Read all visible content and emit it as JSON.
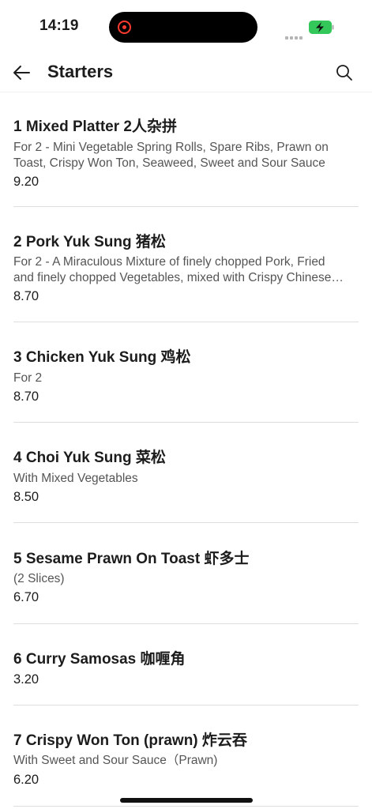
{
  "status_bar": {
    "time": "14:19"
  },
  "header": {
    "title": "Starters"
  },
  "items": [
    {
      "name": "1 Mixed Platter 2人杂拼",
      "desc_line1": "For 2 - Mini Vegetable Spring Rolls, Spare Ribs, Prawn on",
      "desc_line2": "Toast, Crispy Won Ton, Seaweed, Sweet and Sour Sauce",
      "price": "9.20"
    },
    {
      "name": "2 Pork Yuk Sung 猪松",
      "desc_line1": "For 2 - A Miraculous Mixture of finely chopped Pork, Fried",
      "desc_line2": "and finely chopped Vegetables, mixed with Crispy Chinese…",
      "price": "8.70"
    },
    {
      "name": "3 Chicken Yuk Sung 鸡松",
      "desc_line1": "For 2",
      "price": "8.70"
    },
    {
      "name": "4 Choi Yuk Sung 菜松",
      "desc_line1": "With Mixed Vegetables",
      "price": "8.50"
    },
    {
      "name": "5 Sesame Prawn On Toast 虾多士",
      "desc_line1": "(2 Slices)",
      "price": "6.70"
    },
    {
      "name": "6 Curry Samosas 咖喱角",
      "price": "3.20"
    },
    {
      "name": "7 Crispy Won Ton (prawn) 炸云吞",
      "desc_line1": "With Sweet and Sour Sauce（Prawn)",
      "price": "6.20"
    }
  ]
}
